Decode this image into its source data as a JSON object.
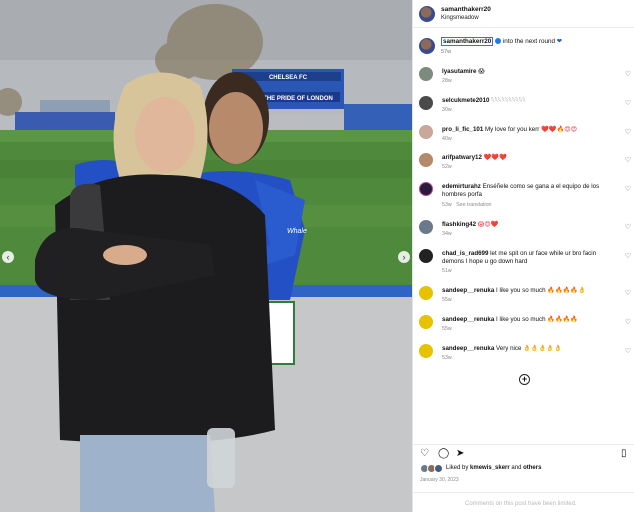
{
  "post": {
    "username": "samanthakerr20",
    "location": "Kingsmeadow",
    "caption_user": "samanthakerr20",
    "caption_text": "into the next round",
    "caption_time": "57w",
    "photo_text": {
      "stand_sign": "CHELSEA FC",
      "stand_banner": "THE PRIDE OF LONDON",
      "jersey_sponsor": "Whale"
    }
  },
  "comments": [
    {
      "user": "lyasutamire",
      "text": "😱",
      "time": "28w",
      "avatar_color": "#7d8a7e"
    },
    {
      "user": "selcukmete2010",
      "text": "𓆩𓆩𓆩𓆩𓆩𓆩𓆩𓆩𓆩𓆩",
      "time": "30w",
      "avatar_color": "#4a4a4a"
    },
    {
      "user": "pro_li_fic_101",
      "text": "My love for you kerr",
      "emojis": "❤️❤️🔥😍😍",
      "time": "40w",
      "avatar_color": "#c9a79a"
    },
    {
      "user": "arifpatwary12",
      "text": "",
      "emojis": "❤️❤️❤️",
      "time": "52w",
      "avatar_color": "#b58a6a"
    },
    {
      "user": "edemirturahz",
      "text": "Enséñele como se gana a el equipo de los hombres porfa",
      "time": "53w",
      "extra": "See translation",
      "avatar_color": "#2a1a3a"
    },
    {
      "user": "flashking42",
      "text": "",
      "emojis": "😱😍❤️",
      "time": "34w",
      "avatar_color": "#6a7a8a"
    },
    {
      "user": "chad_is_rad699",
      "text": "let me spit on ur face while ur bro facin demons I hope u go down hard",
      "time": "51w",
      "avatar_color": "#222222"
    },
    {
      "user": "sandeep__renuka",
      "text": "I like you so much",
      "emojis": "🔥🔥🔥🔥👌",
      "time": "55w",
      "avatar_color": "#e6c200"
    },
    {
      "user": "sandeep__renuka",
      "text": "I like you so much",
      "emojis": "🔥🔥🔥🔥",
      "time": "55w",
      "avatar_color": "#e6c200"
    },
    {
      "user": "sandeep__renuka",
      "text": "Very nice",
      "emojis": "👌👌👌👌👌",
      "time": "53w",
      "avatar_color": "#e6c200"
    }
  ],
  "likes": {
    "prefix": "Liked by",
    "user": "kmewis_skerr",
    "suffix": "and",
    "others": "others"
  },
  "date": "January 30, 2023",
  "footer_text": "Comments on this post have been limited.",
  "icons": {
    "like": "heart-icon",
    "comment": "comment-icon",
    "share": "share-icon",
    "save": "bookmark-icon",
    "add": "plus-circle-icon"
  },
  "colors": {
    "accent_blue": "#1d7bf0",
    "chelsea_blue": "#1a4fb8",
    "grass": "#4f8a3c"
  }
}
